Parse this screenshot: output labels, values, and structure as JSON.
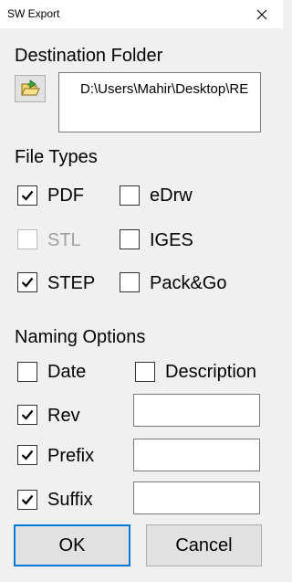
{
  "window": {
    "title": "SW Export",
    "close_icon": "close-icon"
  },
  "destination": {
    "label": "Destination Folder",
    "browse_icon": "folder-open-icon",
    "path": "D:\\Users\\Mahir\\Desktop\\RE"
  },
  "file_types": {
    "label": "File Types",
    "options": [
      {
        "label": "PDF",
        "checked": true,
        "enabled": true
      },
      {
        "label": "eDrw",
        "checked": false,
        "enabled": true
      },
      {
        "label": "STL",
        "checked": false,
        "enabled": false
      },
      {
        "label": "IGES",
        "checked": false,
        "enabled": true
      },
      {
        "label": "STEP",
        "checked": true,
        "enabled": true
      },
      {
        "label": "Pack&Go",
        "checked": false,
        "enabled": true
      }
    ]
  },
  "naming": {
    "label": "Naming Options",
    "options": [
      {
        "label": "Date",
        "checked": false
      },
      {
        "label": "Description",
        "checked": false
      },
      {
        "label": "Rev",
        "checked": true,
        "value": ""
      },
      {
        "label": "Prefix",
        "checked": true,
        "value": ""
      },
      {
        "label": "Suffix",
        "checked": true,
        "value": ""
      }
    ]
  },
  "buttons": {
    "ok": "OK",
    "cancel": "Cancel"
  },
  "colors": {
    "background": "#f0f0f0",
    "focus_border": "#0078d7",
    "disabled_text": "#a0a0a0"
  }
}
